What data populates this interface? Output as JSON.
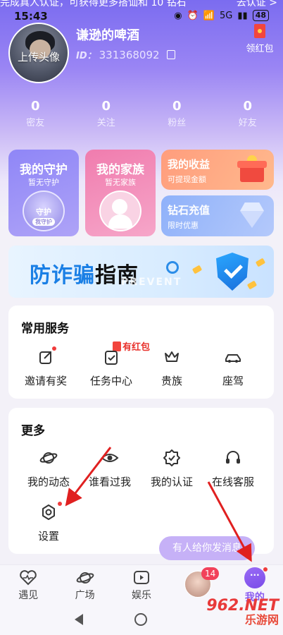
{
  "status_bar": {
    "notice": "完成真人认证，可获得更多搭讪和 10 钻石",
    "notice_action": "去认证 >",
    "time": "15:43",
    "signal": "5G",
    "battery": "48"
  },
  "profile": {
    "avatar_label": "上传头像",
    "username": "谦逊的啤酒",
    "id_label": "ID：",
    "id_value": "331368092",
    "redpacket_label": "领红包"
  },
  "stats": [
    {
      "value": "0",
      "label": "密友"
    },
    {
      "value": "0",
      "label": "关注"
    },
    {
      "value": "0",
      "label": "粉丝"
    },
    {
      "value": "0",
      "label": "好友"
    }
  ],
  "cards": {
    "guard": {
      "title": "我的守护",
      "subtitle": "暂无守护",
      "badge_title": "守护",
      "badge_sub": "我守护"
    },
    "family": {
      "title": "我的家族",
      "subtitle": "暂无家族"
    },
    "income": {
      "title": "我的收益",
      "subtitle": "可提现金额"
    },
    "diamond": {
      "title": "钻石充值",
      "subtitle": "限时优惠"
    }
  },
  "antifraud": {
    "title_blue": "防诈骗",
    "title_dark": "指南",
    "watermark": "PREVENT"
  },
  "common_services": {
    "title": "常用服务",
    "hongbao_tag": "有红包",
    "items": [
      {
        "label": "邀请有奖",
        "icon": "share-icon"
      },
      {
        "label": "任务中心",
        "icon": "task-icon"
      },
      {
        "label": "贵族",
        "icon": "crown-icon"
      },
      {
        "label": "座驾",
        "icon": "car-icon"
      }
    ]
  },
  "more": {
    "title": "更多",
    "items": [
      {
        "label": "我的动态",
        "icon": "planet-icon"
      },
      {
        "label": "谁看过我",
        "icon": "eye-icon"
      },
      {
        "label": "我的认证",
        "icon": "verify-icon"
      },
      {
        "label": "在线客服",
        "icon": "headset-icon"
      },
      {
        "label": "设置",
        "icon": "settings-icon"
      }
    ]
  },
  "bubble": "有人给你发消息",
  "tabs": [
    {
      "label": "遇见",
      "icon": "heart-pulse-icon"
    },
    {
      "label": "广场",
      "icon": "planet-icon"
    },
    {
      "label": "娱乐",
      "icon": "play-icon"
    },
    {
      "label": "",
      "icon": "message-avatar"
    },
    {
      "label": "我的",
      "icon": "me-icon"
    }
  ],
  "message_count": "14",
  "site_watermark": {
    "brand": "962.NET",
    "sub": "乐游网"
  },
  "colors": {
    "accent": "#8a5cf0",
    "red": "#f03c3c",
    "hero_top": "#7b6cf0"
  }
}
